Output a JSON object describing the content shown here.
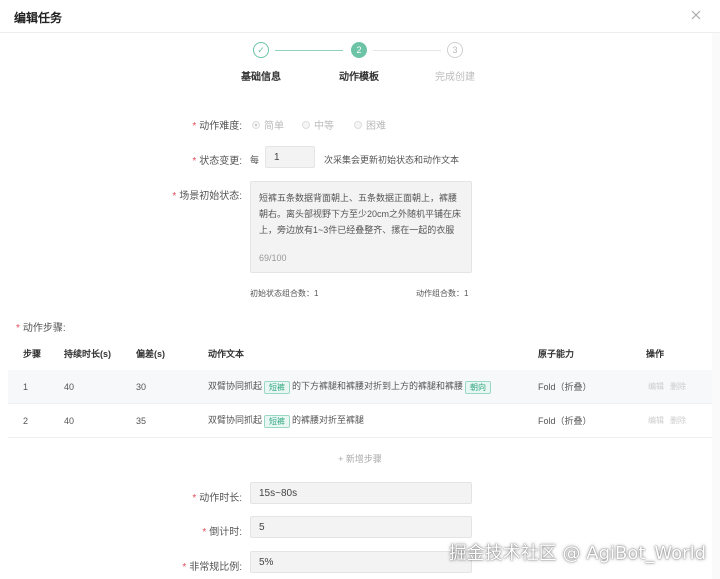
{
  "modal": {
    "title": "编辑任务"
  },
  "steps": [
    {
      "index": "✓",
      "label": "基础信息",
      "state": "done"
    },
    {
      "index": "2",
      "label": "动作模板",
      "state": "active"
    },
    {
      "index": "3",
      "label": "完成创建",
      "state": "pending"
    }
  ],
  "form": {
    "difficulty": {
      "label": "动作难度:",
      "options": [
        "简单",
        "中等",
        "困难"
      ],
      "selected": "简单"
    },
    "state_change": {
      "label": "状态变更:",
      "prefix": "每",
      "value": "1",
      "suffix": "次采集会更新初始状态和动作文本"
    },
    "initial_state": {
      "label": "场景初始状态:",
      "text": "短裤五条数据背面朝上、五条数据正面朝上，裤腰朝右。离头部视野下方至少20cm之外随机平铺在床上，旁边放有1~3件已经叠整齐、摞在一起的衣服",
      "counter": "69/100"
    },
    "combo_initial": "初始状态组合数：1",
    "combo_action": "动作组合数：1"
  },
  "steps_table": {
    "section_label": "动作步骤:",
    "headers": [
      "步骤",
      "持续时长(s)",
      "偏差(s)",
      "动作文本",
      "原子能力",
      "操作"
    ],
    "rows": [
      {
        "step": "1",
        "duration": "40",
        "deviation": "30",
        "text_a": "双臂协同抓起",
        "tag1": "短裤",
        "text_b": "的下方裤腿和裤腰对折到上方的裤腿和裤腰",
        "tag2": "朝向",
        "ability": "Fold（折叠）",
        "edit": "编辑",
        "delete": "删除"
      },
      {
        "step": "2",
        "duration": "40",
        "deviation": "35",
        "text_a": "双臂协同抓起",
        "tag1": "短裤",
        "text_b": "的裤腰对折至裤腿",
        "tag2": "",
        "ability": "Fold（折叠）",
        "edit": "编辑",
        "delete": "删除"
      }
    ],
    "add_label": "+ 新增步骤"
  },
  "bottom_form": {
    "action_duration": {
      "label": "动作时长:",
      "value": "15s~80s"
    },
    "countdown": {
      "label": "倒计时:",
      "value": "5"
    },
    "abnormal_ratio": {
      "label": "非常规比例:",
      "value": "5%"
    }
  },
  "watermark": "掘金技术社区 @ AgiBot_World"
}
